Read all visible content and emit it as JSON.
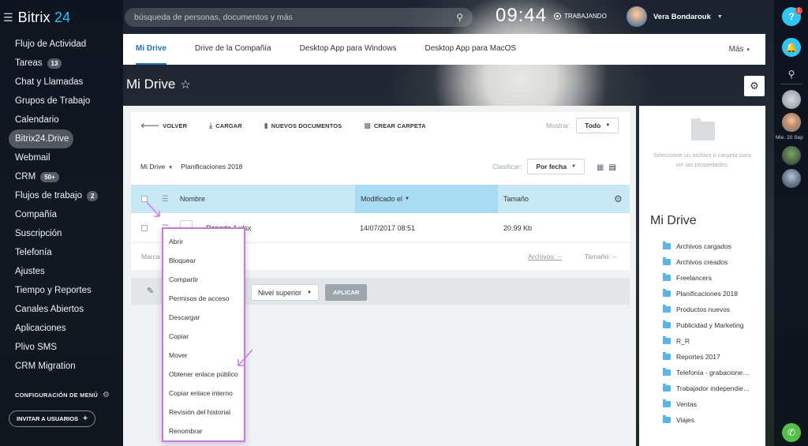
{
  "app": {
    "brand_prefix": "Bitrix",
    "brand_number": "24"
  },
  "sidebar": {
    "items": [
      {
        "label": "Flujo de Actividad"
      },
      {
        "label": "Tareas",
        "badge": "13"
      },
      {
        "label": "Chat y Llamadas"
      },
      {
        "label": "Grupos de Trabajo"
      },
      {
        "label": "Calendario"
      },
      {
        "label": "Bitrix24.Drive",
        "active": true
      },
      {
        "label": "Webmail"
      },
      {
        "label": "CRM",
        "badge": "50+"
      },
      {
        "label": "Flujos de trabajo",
        "badge": "2"
      },
      {
        "label": "Compañía"
      },
      {
        "label": "Suscripción"
      },
      {
        "label": "Telefonía"
      },
      {
        "label": "Ajustes"
      },
      {
        "label": "Tiempo y Reportes"
      },
      {
        "label": "Canales Abiertos"
      },
      {
        "label": "Aplicaciones"
      },
      {
        "label": "Plivo SMS"
      },
      {
        "label": "CRM Migration"
      }
    ],
    "menu_config_label": "CONFIGURACIÓN DE MENÚ",
    "invite_label": "INVITAR A USUARIOS"
  },
  "header": {
    "search_placeholder": "búsqueda de personas, documentos y más",
    "clock": "09:44",
    "work_status": "TRABAJANDO",
    "user_name": "Vera Bondarouk"
  },
  "tabs": {
    "items": [
      {
        "label": "Mi Drive",
        "active": true
      },
      {
        "label": "Drive de la Compañía"
      },
      {
        "label": "Desktop App para Windows"
      },
      {
        "label": "Desktop App para MacOS"
      }
    ],
    "more_label": "Más"
  },
  "page": {
    "title": "Mi Drive"
  },
  "toolbar": {
    "back": "VOLVER",
    "upload": "CARGAR",
    "new_docs": "NUEVOS DOCUMENTOS",
    "create_folder": "CREAR CARPETA",
    "show_label": "Mostrar:",
    "show_value": "Todo",
    "sort_label": "Clasificar:",
    "sort_value": "Por fecha"
  },
  "breadcrumb": {
    "root": "Mi Drive",
    "current": "Planificaciones 2018"
  },
  "table": {
    "col_name": "Nombre",
    "col_modified": "Modificado el",
    "col_size": "Tamaño",
    "rows": [
      {
        "name": "Reporte 1.xlsx",
        "modified": "14/07/2017 08:51",
        "size": "20.99 Kb"
      }
    ],
    "footer_left": "Marca",
    "files_label": "Archivos: --",
    "size_label": "Tamaño: --"
  },
  "actions": {
    "level_value": "Nivel superior",
    "apply_label": "APLICAR"
  },
  "context_menu": {
    "items": [
      "Abrir",
      "Bloquear",
      "Compartir",
      "Permisos de acceso",
      "Descargar",
      "Copiar",
      "Mover",
      "Obtener enlace público",
      "Copiar enlace interno",
      "Revisión del historial",
      "Renombrar"
    ]
  },
  "details": {
    "hint": "Seleccione un archivo o carpeta para ver las propiedades.",
    "title": "Mi Drive",
    "folders": [
      "Archivos cargados",
      "Archivos creados",
      "Freelancers",
      "Planificaciones 2018",
      "Productos nuevos",
      "Publicidad y Marketing",
      "R_R",
      "Reportes 2017",
      "Telefonía - grabacione…",
      "Trabajador independie…",
      "Ventas",
      "Viajes"
    ]
  },
  "rail": {
    "help_badge": "1",
    "date_label": "Mie. 20 Sep"
  },
  "colors": {
    "accent": "#2fc6f6",
    "tab_active": "#1f73b8",
    "highlight": "#c879e3",
    "table_header": "#c9e8f6"
  }
}
